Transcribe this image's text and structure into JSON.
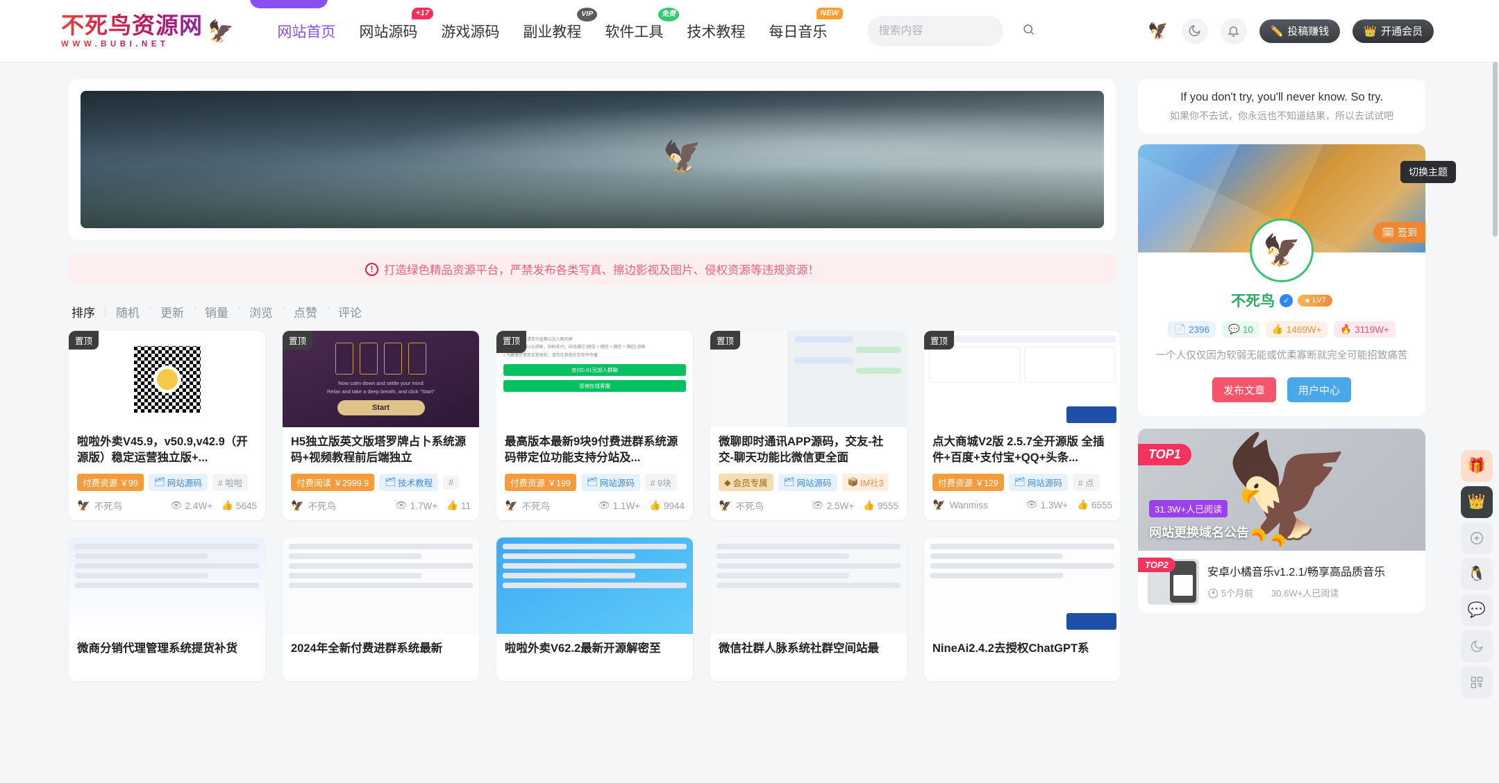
{
  "site": {
    "logo_main": "不死鸟资源网",
    "logo_sub": "WWW.BUBI.NET",
    "logo_bird_icon": "bird-icon"
  },
  "nav": {
    "items": [
      {
        "label": "网站首页",
        "badge": "",
        "active": true
      },
      {
        "label": "网站源码",
        "badge": "+17",
        "badge_style": "red"
      },
      {
        "label": "游戏源码",
        "badge": ""
      },
      {
        "label": "副业教程",
        "badge": "VIP",
        "badge_style": "dark"
      },
      {
        "label": "软件工具",
        "badge": "免费",
        "badge_style": "green"
      },
      {
        "label": "技术教程",
        "badge": ""
      },
      {
        "label": "每日音乐",
        "badge": "NEW",
        "badge_style": "orange"
      }
    ]
  },
  "search": {
    "placeholder": "搜索内容",
    "value": "",
    "icon": "search-icon"
  },
  "header_actions": {
    "bird_icon": "bird-icon",
    "theme_icon": "moon-icon",
    "bell_icon": "bell-icon",
    "submit_label": "投稿赚钱",
    "submit_icon": "pencil-icon",
    "vip_label": "开通会员",
    "vip_icon": "crown-icon"
  },
  "notice": {
    "icon": "exclamation-circle-icon",
    "text": "打造绿色精品资源平台，严禁发布各类写真、擦边影视及图片、侵权资源等违规资源！"
  },
  "sort": {
    "label": "排序",
    "items": [
      "随机",
      "更新",
      "销量",
      "浏览",
      "点赞",
      "评论"
    ]
  },
  "cards": [
    {
      "pin": "置顶",
      "title": "啦啦外卖V45.9，v50.9,v42.9（开源版）稳定运营独立版+...",
      "tags": [
        {
          "text": "付费资源 ￥99",
          "style": "orange"
        },
        {
          "text": "网站源码",
          "style": "blue",
          "icon": "folder-icon"
        },
        {
          "text": "# 啦啦",
          "style": "hash"
        }
      ],
      "author": "不死鸟",
      "views": "2.4W+",
      "likes": "5645"
    },
    {
      "pin": "置顶",
      "title": "H5独立版英文版塔罗牌占卜系统源码+视频教程前后端独立",
      "tags": [
        {
          "text": "付费阅读 ￥2999.9",
          "style": "orange"
        },
        {
          "text": "技术教程",
          "style": "blue",
          "icon": "folder-icon"
        },
        {
          "text": "#",
          "style": "hash"
        }
      ],
      "author": "不死鸟",
      "views": "1.7W+",
      "likes": "11"
    },
    {
      "pin": "置顶",
      "title": "最高版本最新9块9付费进群系统源码带定位功能支持分站及...",
      "tags": [
        {
          "text": "付费资源 ￥199",
          "style": "orange"
        },
        {
          "text": "网站源码",
          "style": "blue",
          "icon": "folder-icon"
        },
        {
          "text": "# 9块",
          "style": "hash"
        }
      ],
      "author": "不死鸟",
      "views": "1.1W+",
      "likes": "9944"
    },
    {
      "pin": "置顶",
      "title": "微聊即时通讯APP源码，交友-社交-聊天功能比微信更全面",
      "tags": [
        {
          "text": "会员专属",
          "style": "gold",
          "icon": "diamond-icon"
        },
        {
          "text": "网站源码",
          "style": "blue",
          "icon": "folder-icon"
        },
        {
          "text": "IM社3",
          "style": "im",
          "icon": "box-icon"
        }
      ],
      "author": "不死鸟",
      "views": "2.5W+",
      "likes": "9555"
    },
    {
      "pin": "置顶",
      "title": "点大商城V2版 2.5.7全开源版 全插件+百度+支付宝+QQ+头条...",
      "tags": [
        {
          "text": "付费资源 ￥129",
          "style": "orange"
        },
        {
          "text": "网站源码",
          "style": "blue",
          "icon": "folder-icon"
        },
        {
          "text": "# 点",
          "style": "hash"
        }
      ],
      "author": "Wanmiss",
      "views": "1.3W+",
      "likes": "6555"
    }
  ],
  "cards_row2": [
    {
      "title": "微商分销代理管理系统提货补货"
    },
    {
      "title": "2024年全新付费进群系统最新"
    },
    {
      "title": "啦啦外卖V62.2最新开源解密至"
    },
    {
      "title": "微信社群人脉系统社群空间站最"
    },
    {
      "title": "NineAi2.4.2去授权ChatGPT系"
    }
  ],
  "sidebar": {
    "quote_en": "If you don't try, you'll never know. So try.",
    "quote_cn": "如果你不去试，你永远也不知道结果，所以去试试吧",
    "profile": {
      "signin_label": "签到",
      "signin_icon": "calendar-check-icon",
      "avatar_icon": "phoenix-icon",
      "username": "不死鸟",
      "verified_icon": "check-badge-icon",
      "level": "LV7",
      "level_icon": "star-icon",
      "stats": [
        {
          "icon": "document-icon",
          "value": "2396"
        },
        {
          "icon": "comment-icon",
          "value": "10"
        },
        {
          "icon": "thumbs-up-icon",
          "value": "1469W+"
        },
        {
          "icon": "fire-icon",
          "value": "3119W+"
        }
      ],
      "bio": "一个人仅仅因为软弱无能或优柔寡断就完全可能招致痛苦",
      "publish_label": "发布文章",
      "usercenter_label": "用户中心"
    },
    "rank_hero": {
      "badge": "TOP1",
      "read_count": "31.3W+人已阅读",
      "title": "网站更换域名公告"
    },
    "rank_item2": {
      "badge": "TOP2",
      "title": "安卓小橘音乐v1.2.1/畅享高品质音乐",
      "time": "5个月前",
      "time_icon": "clock-icon",
      "reads": "30.6W+人已阅读"
    }
  },
  "float_bar": {
    "tooltip": "切换主题",
    "buttons": [
      {
        "icon": "gift-icon",
        "style": "gift"
      },
      {
        "icon": "crown-icon",
        "style": "crown"
      },
      {
        "icon": "plus-circle-icon",
        "style": "plain"
      },
      {
        "icon": "qq-penguin-icon",
        "style": "plain"
      },
      {
        "icon": "wechat-icon",
        "style": "plain"
      },
      {
        "icon": "moon-icon",
        "style": "plain"
      },
      {
        "icon": "qrcode-icon",
        "style": "plain"
      }
    ]
  },
  "colors": {
    "accent_purple": "#8a4ff0",
    "notice_bg": "#fdeef0",
    "notice_text": "#f0607e",
    "tag_orange": "#f89b3c",
    "tag_blue_text": "#3d8bf2",
    "top_badge": "#f5325b"
  }
}
